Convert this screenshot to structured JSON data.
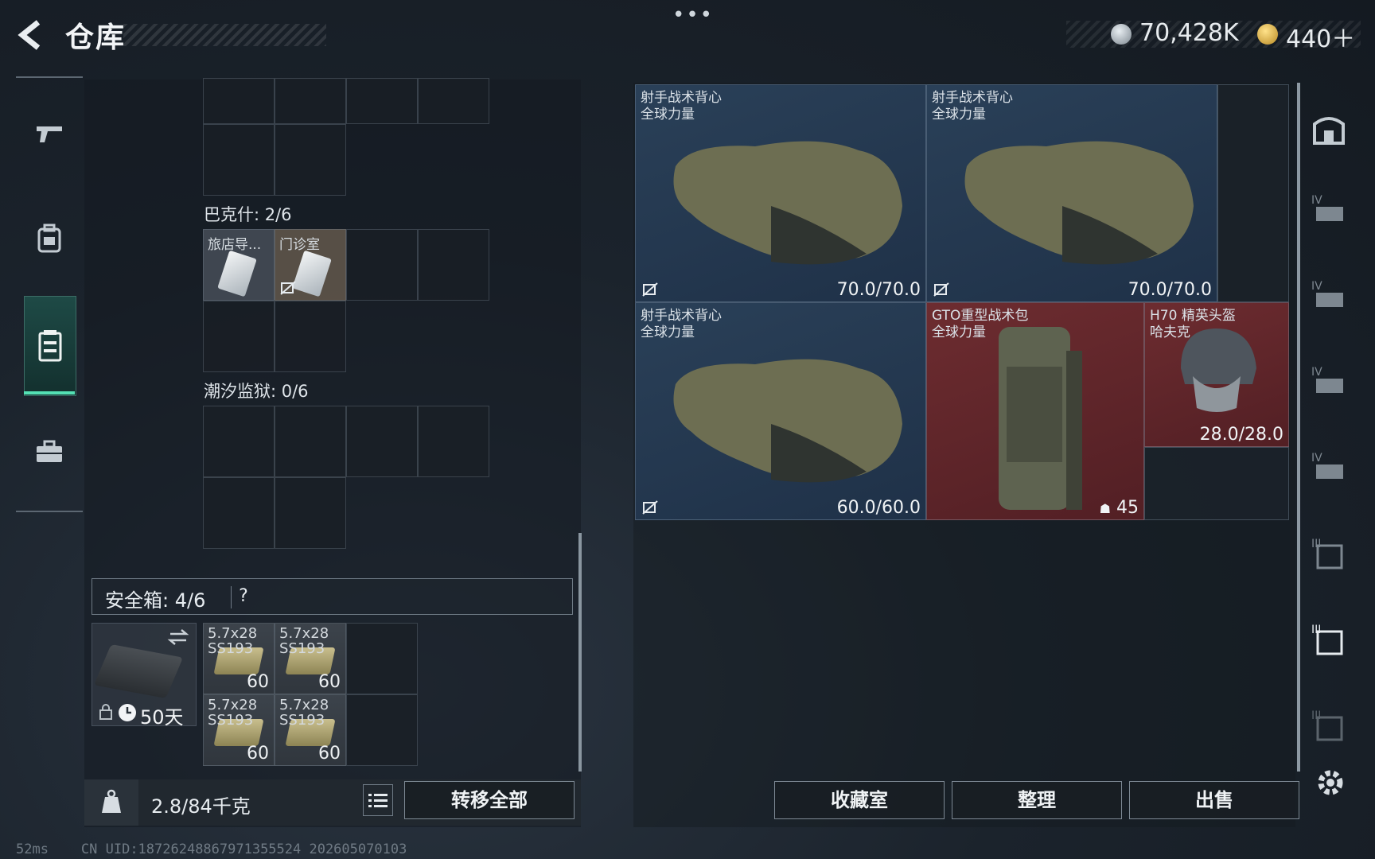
{
  "header": {
    "title": "仓库",
    "menu_dots": "•••"
  },
  "currency": {
    "silver": "70,428K",
    "gold": "440＋"
  },
  "nav": {
    "items": [
      "weapon",
      "backpack",
      "warehouse",
      "toolbox"
    ],
    "active": "warehouse"
  },
  "left": {
    "sections": [
      {
        "label": "巴克什: 2/6"
      },
      {
        "label": "潮汐监狱: 0/6"
      }
    ],
    "keys": [
      {
        "label": "旅店导..."
      },
      {
        "label": "门诊室"
      }
    ],
    "safe_box": {
      "label": "安全箱:  4/6",
      "help": "?",
      "case_time": "50天"
    },
    "ammo": [
      {
        "name": "5.7x28 SS193",
        "count": "60"
      },
      {
        "name": "5.7x28 SS193",
        "count": "60"
      },
      {
        "name": "5.7x28 SS193",
        "count": "60"
      },
      {
        "name": "5.7x28 SS193",
        "count": "60"
      }
    ],
    "weight": "2.8/84千克",
    "transfer_all": "转移全部"
  },
  "right": {
    "items": [
      {
        "name": "射手战术背心",
        "sub": "全球力量",
        "durability": "70.0/70.0"
      },
      {
        "name": "射手战术背心",
        "sub": "全球力量",
        "durability": "70.0/70.0"
      },
      {
        "name": "射手战术背心",
        "sub": "全球力量",
        "durability": "60.0/60.0"
      },
      {
        "name": "GTO重型战术包",
        "sub": "全球力量",
        "capacity": "45"
      },
      {
        "name": "H70 精英头盔",
        "sub": "哈夫克",
        "durability": "28.0/28.0"
      }
    ],
    "buttons": {
      "collection": "收藏室",
      "sort": "整理",
      "sell": "出售"
    }
  },
  "filters": [
    "IV",
    "IV",
    "IV",
    "IV",
    "III",
    "III",
    "III"
  ],
  "status": {
    "ping": "52ms",
    "uid": "CN UID:18726248867971355524 202605070103"
  },
  "colors": {
    "accent": "#54e0b4",
    "blue_item": "#2a4058",
    "red_item": "#6d2c30"
  }
}
